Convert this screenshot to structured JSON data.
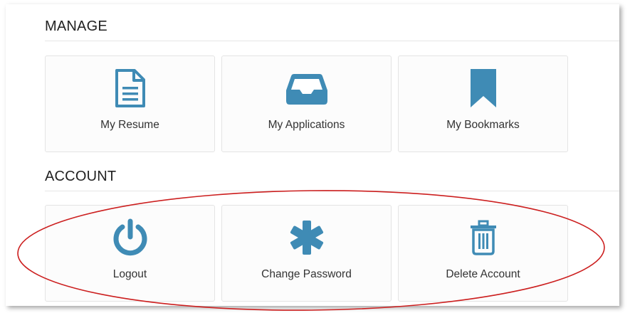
{
  "colors": {
    "icon": "#3f8bb5",
    "annotation": "#cc1f1f"
  },
  "manage": {
    "title": "MANAGE",
    "tiles": [
      {
        "label": "My Resume",
        "icon": "document-icon"
      },
      {
        "label": "My Applications",
        "icon": "inbox-tray-icon"
      },
      {
        "label": "My Bookmarks",
        "icon": "bookmark-icon"
      }
    ]
  },
  "account": {
    "title": "ACCOUNT",
    "tiles": [
      {
        "label": "Logout",
        "icon": "power-icon"
      },
      {
        "label": "Change Password",
        "icon": "asterisk-icon"
      },
      {
        "label": "Delete Account",
        "icon": "trash-icon"
      }
    ]
  }
}
